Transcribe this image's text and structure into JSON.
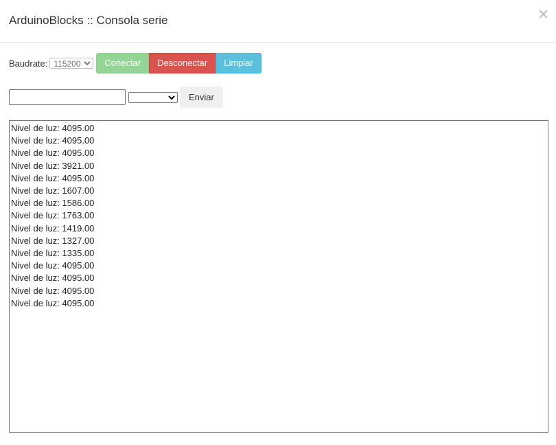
{
  "header": {
    "title": "ArduinoBlocks :: Consola serie",
    "close_glyph": "×"
  },
  "toolbar": {
    "baud_label": "Baudrate:",
    "baud_selected": "115200",
    "connect_label": "Conectar",
    "disconnect_label": "Desconectar",
    "clear_label": "Limpiar"
  },
  "send": {
    "input_value": "",
    "line_ending_selected": "",
    "send_label": "Enviar"
  },
  "console": {
    "lines": [
      "Nivel de luz: 4095.00",
      "Nivel de luz: 4095.00",
      "Nivel de luz: 4095.00",
      "Nivel de luz: 3921.00",
      "Nivel de luz: 4095.00",
      "Nivel de luz: 1607.00",
      "Nivel de luz: 1586.00",
      "Nivel de luz: 1763.00",
      "Nivel de luz: 1419.00",
      "Nivel de luz: 1327.00",
      "Nivel de luz: 1335.00",
      "Nivel de luz: 4095.00",
      "Nivel de luz: 4095.00",
      "Nivel de luz: 4095.00",
      "Nivel de luz: 4095.00"
    ]
  },
  "colors": {
    "connect": "#94d494",
    "disconnect": "#d9534f",
    "clear": "#5bc0de",
    "send": "#efefef"
  },
  "icons": {
    "close": "close-icon"
  }
}
